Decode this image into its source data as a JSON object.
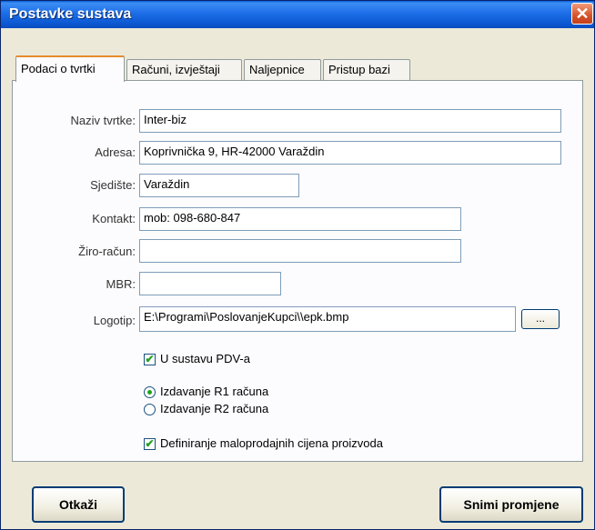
{
  "window": {
    "title": "Postavke sustava",
    "close_glyph": "✕"
  },
  "tabs": [
    {
      "label": "Podaci o tvrtki",
      "active": true
    },
    {
      "label": "Računi, izvještaji"
    },
    {
      "label": "Naljepnice"
    },
    {
      "label": "Pristup bazi"
    }
  ],
  "form": {
    "naziv": {
      "label": "Naziv tvrtke:",
      "value": "Inter-biz"
    },
    "adresa": {
      "label": "Adresa:",
      "value": "Koprivnička 9, HR-42000 Varaždin"
    },
    "sjediste": {
      "label": "Sjedište:",
      "value": "Varaždin"
    },
    "kontakt": {
      "label": "Kontakt:",
      "value": "mob: 098-680-847"
    },
    "ziro": {
      "label": "Žiro-račun:",
      "value": ""
    },
    "mbr": {
      "label": "MBR:",
      "value": ""
    },
    "logotip": {
      "label": "Logotip:",
      "value": "E:\\Programi\\PoslovanjeKupci\\\\epk.bmp",
      "browse_label": "..."
    }
  },
  "options": {
    "pdv": {
      "label": "U sustavu PDV-a",
      "checked": true
    },
    "r1": {
      "label": "Izdavanje R1 računa",
      "selected": true
    },
    "r2": {
      "label": "Izdavanje R2 računa",
      "selected": false
    },
    "maloprodajne": {
      "label": "Definiranje maloprodajnih cijena proizvoda",
      "checked": true
    },
    "check_glyph": "✔"
  },
  "buttons": {
    "cancel": "Otkaži",
    "save": "Snimi promjene"
  },
  "colors": {
    "titlebar": "#0b57d0",
    "accent_tab": "#e68b2c",
    "check": "#21a121",
    "close": "#d5532b"
  }
}
